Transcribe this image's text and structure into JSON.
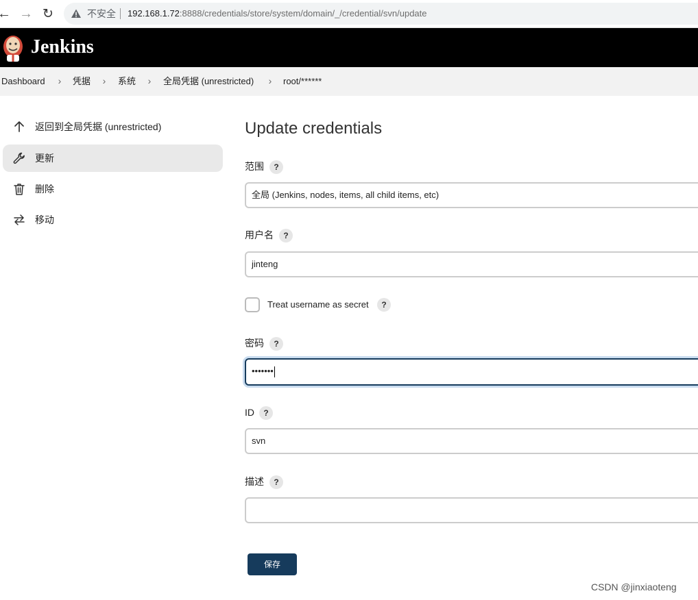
{
  "browser": {
    "insecure_label": "不安全",
    "url_host": "192.168.1.72",
    "url_rest": ":8888/credentials/store/system/domain/_/credential/svn/update"
  },
  "app": {
    "title": "Jenkins"
  },
  "breadcrumb": {
    "items": [
      "Dashboard",
      "凭据",
      "系统",
      "全局凭据 (unrestricted)",
      "root/******"
    ]
  },
  "sidebar": {
    "items": [
      {
        "label": "返回到全局凭据 (unrestricted)",
        "icon": "arrow-up-icon"
      },
      {
        "label": "更新",
        "icon": "wrench-icon"
      },
      {
        "label": "删除",
        "icon": "trash-icon"
      },
      {
        "label": "移动",
        "icon": "swap-arrows-icon"
      }
    ]
  },
  "form": {
    "title": "Update credentials",
    "help_symbol": "?",
    "scope": {
      "label": "范围",
      "value": "全局 (Jenkins, nodes, items, all child items, etc)"
    },
    "username": {
      "label": "用户名",
      "value": "jinteng"
    },
    "treat_secret": {
      "label": "Treat username as secret",
      "checked": false
    },
    "password": {
      "label": "密码",
      "value": "•••••••"
    },
    "id": {
      "label": "ID",
      "value": "svn"
    },
    "description": {
      "label": "描述",
      "value": ""
    },
    "save_label": "保存"
  },
  "watermark": "CSDN @jinxiaoteng",
  "colors": {
    "header_bg": "#000000",
    "primary": "#163b5c",
    "breadcrumb_bg": "#f2f2f2"
  }
}
